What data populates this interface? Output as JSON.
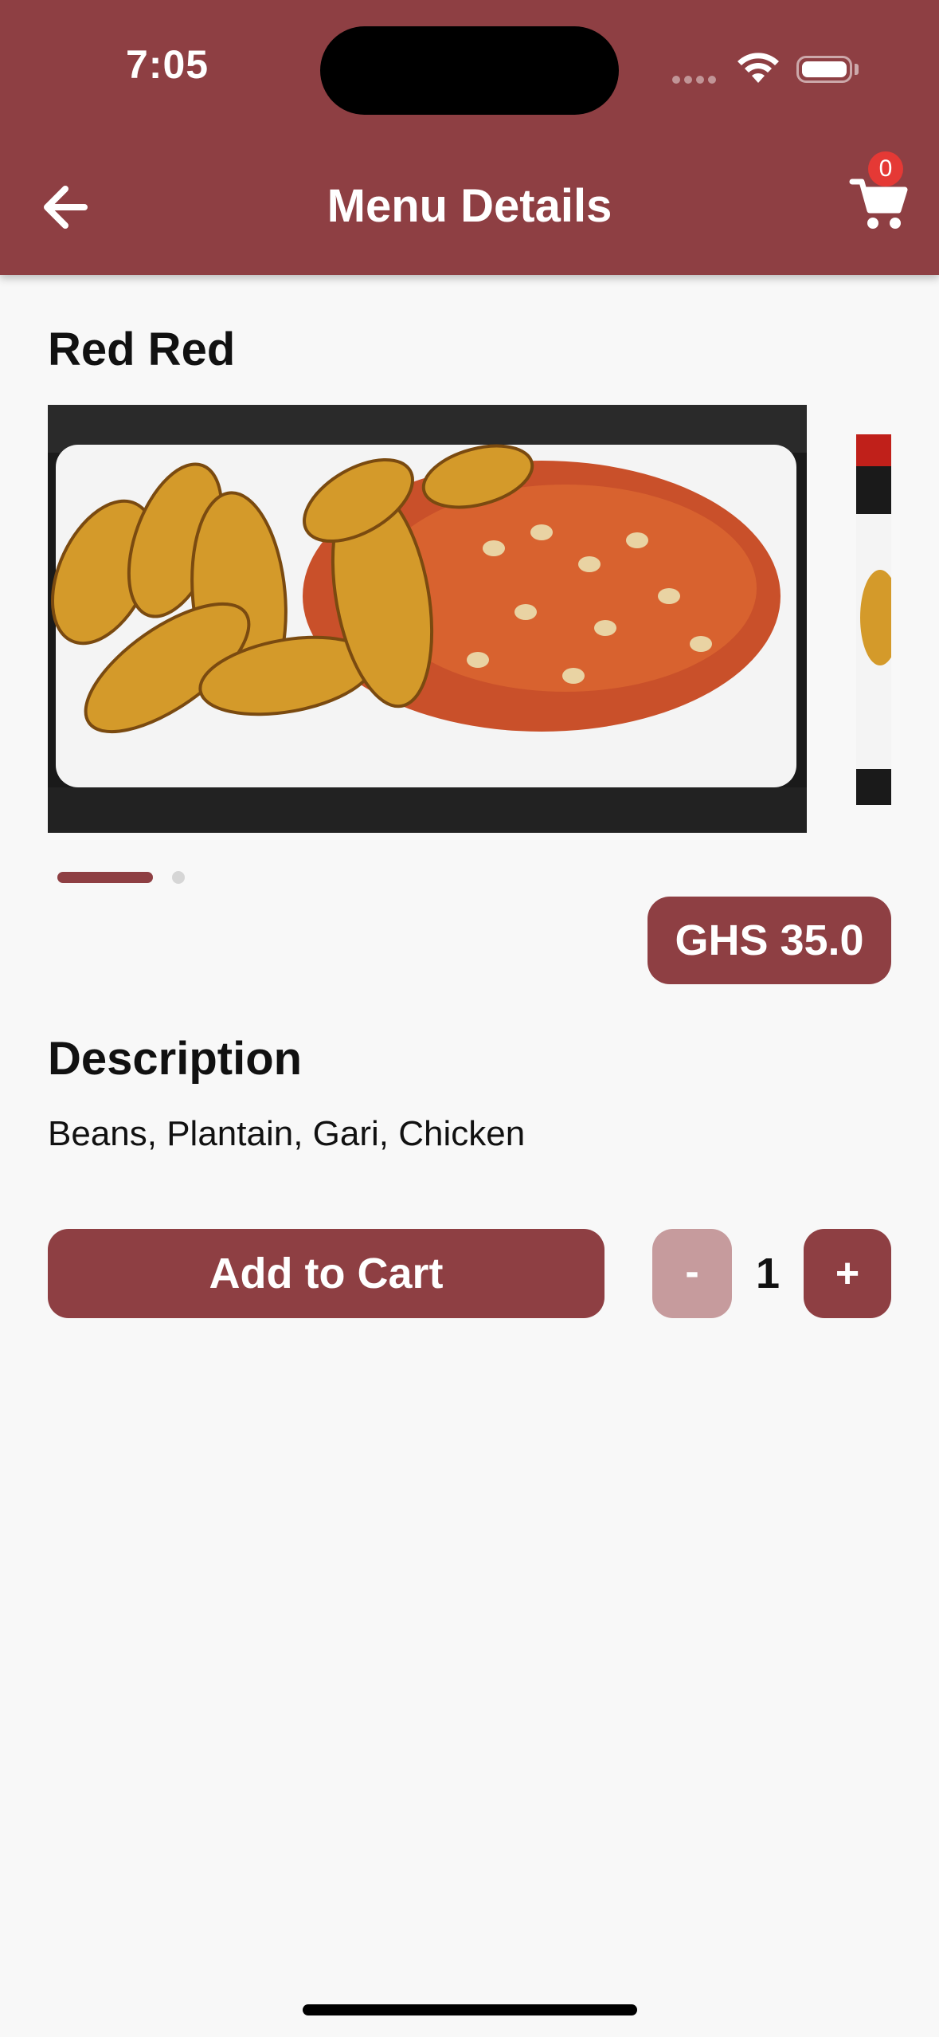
{
  "status_bar": {
    "time": "7:05"
  },
  "header": {
    "title": "Menu Details",
    "cart_count": "0"
  },
  "item": {
    "name": "Red Red",
    "price": "GHS 35.0",
    "description_heading": "Description",
    "description": "Beans, Plantain, Gari, Chicken"
  },
  "carousel": {
    "image_count": 2,
    "active_index": 0
  },
  "actions": {
    "add_to_cart_label": "Add to Cart",
    "minus_label": "-",
    "plus_label": "+",
    "quantity": "1"
  },
  "colors": {
    "primary": "#8e3f43",
    "primary_disabled": "#c69b9d",
    "badge": "#e53935",
    "background": "#f8f8f8"
  }
}
